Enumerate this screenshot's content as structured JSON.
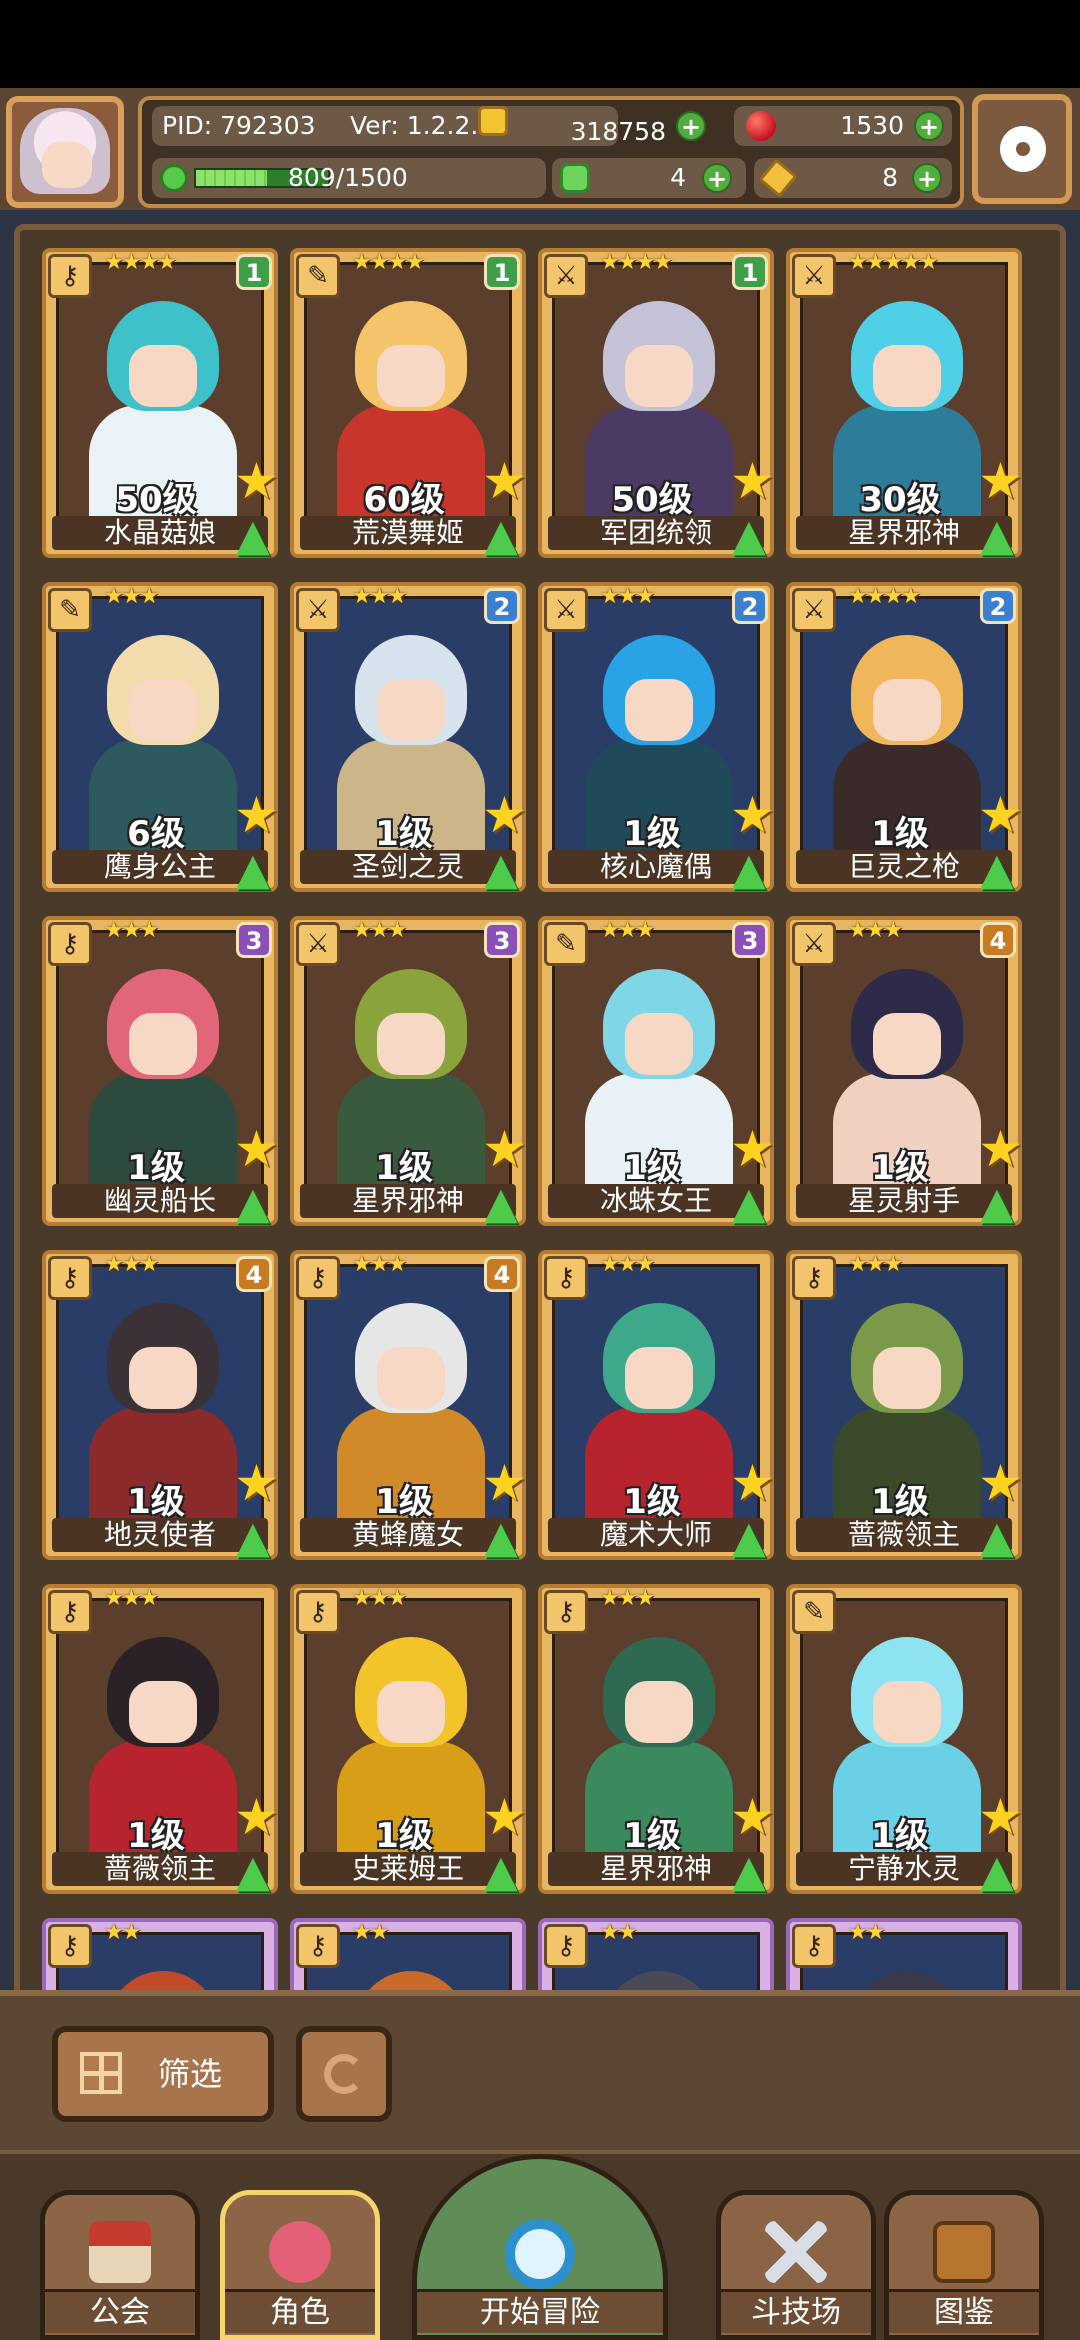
{
  "header": {
    "pid": "PID: 792303",
    "version": "Ver: 1.2.2.2",
    "gold": "318758",
    "gems": "1530",
    "exp_text": "809/1500",
    "exp_fraction": 0.539,
    "clovers": "4",
    "keys": "8"
  },
  "cards": [
    {
      "name": "水晶菇娘",
      "level": "50级",
      "stars": "★★★★",
      "badge": "1",
      "hair": "#3fc1c9",
      "body": "#e9f2f7",
      "weapon_icon": "key-icon"
    },
    {
      "name": "荒漠舞姬",
      "level": "60级",
      "stars": "★★★★",
      "badge": "1",
      "hair": "#f4c46a",
      "body": "#c8352a",
      "weapon_icon": "scroll-icon"
    },
    {
      "name": "军团统领",
      "level": "50级",
      "stars": "★★★★",
      "badge": "1",
      "hair": "#c4c2d6",
      "body": "#4a3a64",
      "weapon_icon": "sword-icon"
    },
    {
      "name": "星界邪神",
      "level": "30级",
      "stars": "★★★★★",
      "badge": "",
      "hair": "#4fd0e6",
      "body": "#2d7d9a",
      "weapon_icon": "sword-icon"
    },
    {
      "name": "鹰身公主",
      "level": "6级",
      "stars": "★★★",
      "badge": "",
      "hair": "#f2dcae",
      "body": "#2c5a5e",
      "weapon_icon": "scroll-icon"
    },
    {
      "name": "圣剑之灵",
      "level": "1级",
      "stars": "★★★",
      "badge": "2",
      "hair": "#d6e2ec",
      "body": "#cdb58a",
      "weapon_icon": "sword-icon"
    },
    {
      "name": "核心魔偶",
      "level": "1级",
      "stars": "★★★",
      "badge": "2",
      "hair": "#2aa3e6",
      "body": "#1f4a5a",
      "weapon_icon": "sword-icon"
    },
    {
      "name": "巨灵之枪",
      "level": "1级",
      "stars": "★★★★",
      "badge": "2",
      "hair": "#f0b65a",
      "body": "#3a2a2a",
      "weapon_icon": "sword-icon"
    },
    {
      "name": "幽灵船长",
      "level": "1级",
      "stars": "★★★",
      "badge": "3",
      "hair": "#e2667a",
      "body": "#2c4a3e",
      "weapon_icon": "key-icon"
    },
    {
      "name": "星界邪神",
      "level": "1级",
      "stars": "★★★",
      "badge": "3",
      "hair": "#8aa33a",
      "body": "#3a5a3e",
      "weapon_icon": "sword-icon"
    },
    {
      "name": "冰蛛女王",
      "level": "1级",
      "stars": "★★★",
      "badge": "3",
      "hair": "#7fd6e6",
      "body": "#e8f2f6",
      "weapon_icon": "scroll-icon"
    },
    {
      "name": "星灵射手",
      "level": "1级",
      "stars": "★★★",
      "badge": "4",
      "hair": "#2d2a4a",
      "body": "#f0d0c0",
      "weapon_icon": "sword-icon"
    },
    {
      "name": "地灵使者",
      "level": "1级",
      "stars": "★★★",
      "badge": "4",
      "hair": "#3a3236",
      "body": "#8a2a2a",
      "weapon_icon": "key-icon"
    },
    {
      "name": "黄蜂魔女",
      "level": "1级",
      "stars": "★★★",
      "badge": "4",
      "hair": "#e6e6e6",
      "body": "#d08a2a",
      "weapon_icon": "key-icon"
    },
    {
      "name": "魔术大师",
      "level": "1级",
      "stars": "★★★",
      "badge": "",
      "hair": "#3ea88a",
      "body": "#b8242e",
      "weapon_icon": "key-icon"
    },
    {
      "name": "蔷薇领主",
      "level": "1级",
      "stars": "★★★",
      "badge": "",
      "hair": "#7a9a4a",
      "body": "#3a4a2a",
      "weapon_icon": "key-icon"
    },
    {
      "name": "蔷薇领主",
      "level": "1级",
      "stars": "★★★",
      "badge": "",
      "hair": "#2a2226",
      "body": "#b8242e",
      "weapon_icon": "key-icon"
    },
    {
      "name": "史莱姆王",
      "level": "1级",
      "stars": "★★★",
      "badge": "",
      "hair": "#f2c42a",
      "body": "#d89e18",
      "weapon_icon": "key-icon"
    },
    {
      "name": "星界邪神",
      "level": "1级",
      "stars": "★★★",
      "badge": "",
      "hair": "#2e6a52",
      "body": "#3a8a5e",
      "weapon_icon": "key-icon"
    },
    {
      "name": "宁静水灵",
      "level": "1级",
      "stars": "",
      "badge": "",
      "hair": "#8ee3f0",
      "body": "#6ad0e6",
      "weapon_icon": "scroll-icon"
    }
  ],
  "partial_cards": [
    {
      "stars": "★★",
      "hair": "#c04a2a"
    },
    {
      "stars": "★★",
      "hair": "#c86a2a"
    },
    {
      "stars": "★★",
      "hair": "#4a4a56"
    },
    {
      "stars": "★★",
      "hair": "#3a3a4a"
    }
  ],
  "controls": {
    "filter_label": "筛选"
  },
  "nav": {
    "guild": "公会",
    "role": "角色",
    "adventure": "开始冒险",
    "arena": "斗技场",
    "codex": "图鉴"
  }
}
